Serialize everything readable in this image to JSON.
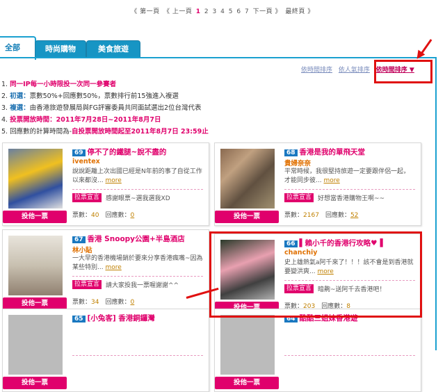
{
  "pager": {
    "first": "《 第一頁",
    "prev": "《 上一頁",
    "pages": [
      "1",
      "2",
      "3",
      "4",
      "5",
      "6",
      "7"
    ],
    "current": "1",
    "next": "下一頁 》",
    "last": "最終頁 》"
  },
  "tabs": [
    {
      "label": "全部",
      "active": true
    },
    {
      "label": "時尚購物",
      "active": false
    },
    {
      "label": "美食旅遊",
      "active": false
    }
  ],
  "sort": {
    "by_latest": "依時間排序",
    "by_popularity": "依人氣排序",
    "by_time": "依時間排序 ▼"
  },
  "rules": [
    {
      "n": "1.",
      "text": "同一IP每一小時限投一次同一參賽者"
    },
    {
      "n": "2.",
      "head": "初選：",
      "text": "票數50%+回應數50%，票數排行前15強進入複選"
    },
    {
      "n": "3.",
      "head": "複選：",
      "text": "由香港旅遊發展局與FG評審委員共同面試選出2位台灣代表"
    },
    {
      "n": "4.",
      "text": "投票開放時間：2011年7月28日~2011年8月7日"
    },
    {
      "n": "5.",
      "head": "回應數的計算時間為-",
      "text": "自投票開放時間起至2011年8月7日 23:59止"
    }
  ],
  "vote_label": "投他一票",
  "more_label": "more",
  "badge_label": "拉票宣言",
  "votes_prefix": "票數：",
  "replies_prefix": "回應數：",
  "entries": [
    {
      "id": "69",
      "title": "停不了的鐵腿~說不盡的",
      "author": "iventex",
      "desc": "說說距離上次出國已經是N年前的事了自從工作以來都沒...",
      "comment": "感謝眼票~選我選我XD",
      "votes": "40",
      "replies": "0"
    },
    {
      "id": "68",
      "title": "香港是我的單飛天堂",
      "author": "貴婦奈奈",
      "desc": "平常時候，我很堅持旅遊一定要跟伴侶一起，才能同步彼...",
      "comment": "好想當香港購物王啊~~",
      "votes": "2167",
      "replies": "52"
    },
    {
      "id": "67",
      "title": "香港 Snoopy公園+半島酒店",
      "author": "林小貼",
      "desc": "一大早的香港機場銷於要來分享香港瘋嘴~因為某些特別...",
      "comment": "請大家投我一票喔謝謝^^",
      "votes": "34",
      "replies": "0"
    },
    {
      "id": "66",
      "title": "▌賴小千的香港行攻略♥▐",
      "author": "chanchiy",
      "desc": "史上雄熱氣a阿千來了！！！該不會是到香港就要變洪爽...",
      "comment": "暗齁~送阿千去香港吧！",
      "votes": "203",
      "replies": "8"
    },
    {
      "id": "65",
      "title": "[小兔客] 香港銅鑼灣",
      "author": "",
      "desc": "",
      "comment": "",
      "votes": "",
      "replies": ""
    },
    {
      "id": "64",
      "title": "酷酷三姐妹香港遊",
      "author": "",
      "desc": "",
      "comment": "",
      "votes": "",
      "replies": ""
    }
  ],
  "colors": {
    "accent": "#e0006c",
    "tab": "#1795c4",
    "highlight": "#e01010"
  }
}
